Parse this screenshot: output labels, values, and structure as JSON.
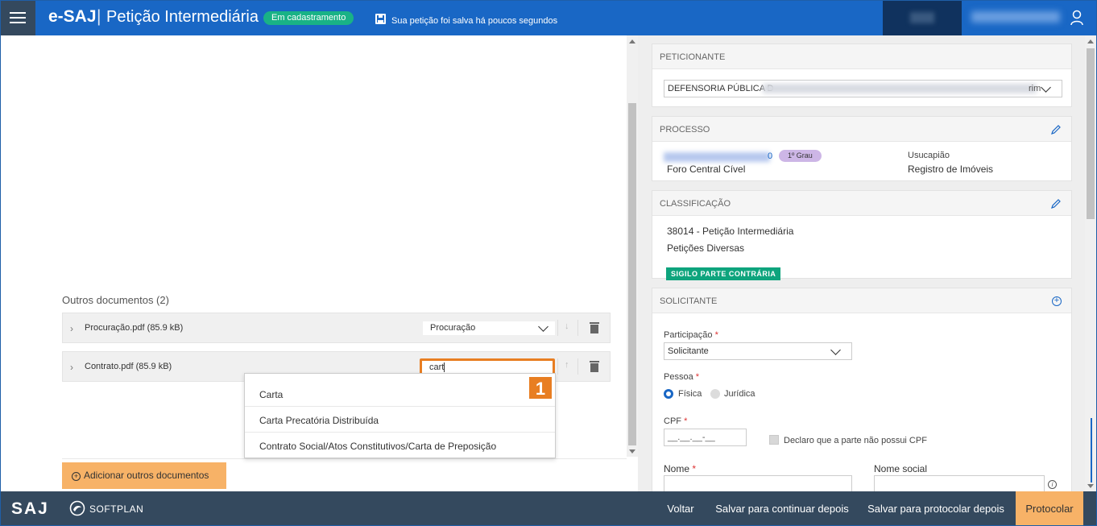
{
  "header": {
    "brand": "e-SAJ",
    "separator": "|",
    "title": "Petição Intermediária",
    "status_badge": "Em cadastramento",
    "save_status": "Sua petição foi salva há poucos segundos"
  },
  "left": {
    "section_title": "Outros documentos (2)",
    "documents": [
      {
        "filename": "Procuração.pdf (85.9 kB)",
        "type_value": "Procuração"
      },
      {
        "filename": "Contrato.pdf (85.9 kB)",
        "type_value": "cart"
      }
    ],
    "step_marker": "1",
    "dropdown_options": [
      "Carta",
      "Carta Precatória Distribuída",
      "Contrato Social/Atos Constitutivos/Carta de Preposição"
    ],
    "add_button": "Adicionar outros documentos"
  },
  "right": {
    "peticionante": {
      "header": "PETICIONANTE",
      "select_value": "DEFENSORIA PÚBLICA D",
      "select_tail": "rim"
    },
    "processo": {
      "header": "PROCESSO",
      "number_suffix": "0",
      "grau": "1º Grau",
      "foro": "Foro Central Cível",
      "classe": "Usucapião",
      "assunto": "Registro de Imóveis"
    },
    "classificacao": {
      "header": "CLASSIFICAÇÃO",
      "line1": "38014 - Petição Intermediária",
      "line2": "Petições Diversas",
      "badge": "SIGILO PARTE CONTRÁRIA"
    },
    "solicitante": {
      "header": "SOLICITANTE",
      "participacao_label": "Participação",
      "participacao_value": "Solicitante",
      "pessoa_label": "Pessoa",
      "fisica": "Física",
      "juridica": "Jurídica",
      "cpf_label": "CPF",
      "cpf_placeholder": "__.__.__-__",
      "no_cpf_label": "Declaro que a parte não possui CPF",
      "nome_label": "Nome",
      "nome_social_label": "Nome social",
      "required_mark": "*",
      "info_glyph": "i"
    }
  },
  "footer": {
    "logo": "SAJ",
    "softplan": "SOFTPLAN",
    "voltar": "Voltar",
    "salvar_continuar": "Salvar para continuar depois",
    "salvar_protocolar": "Salvar para protocolar depois",
    "protocolar": "Protocolar"
  },
  "colors": {
    "header_blue": "#1967c5",
    "dark_slate": "#34495e",
    "accent_orange": "#e87e22",
    "button_orange": "#f7b267",
    "status_green": "#19b286",
    "sigilo_green": "#0ea47d",
    "grau_purple": "#cdb6e6"
  }
}
